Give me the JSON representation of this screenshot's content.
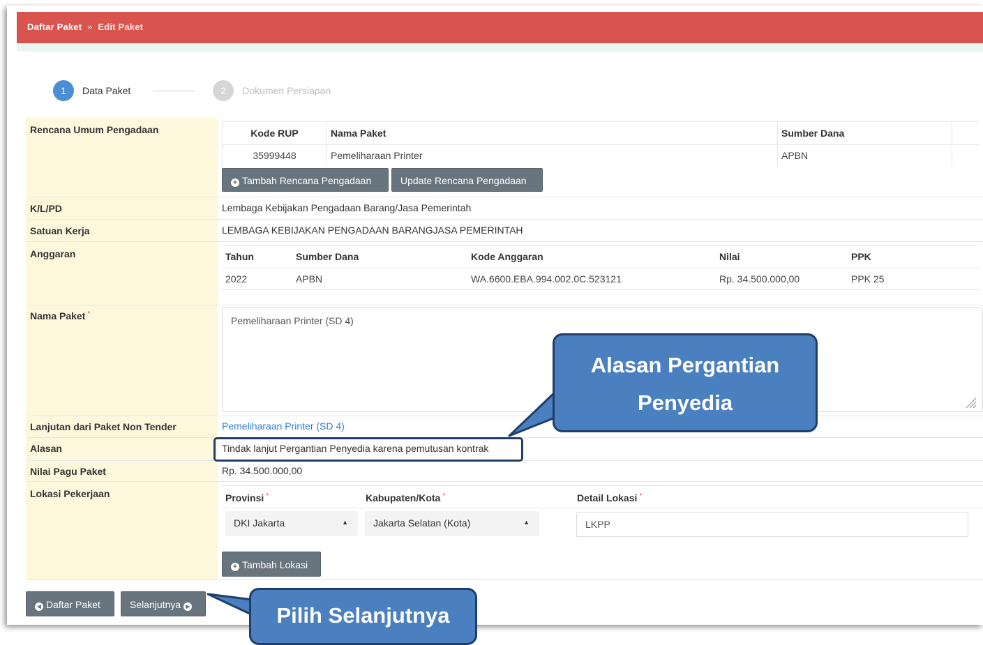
{
  "breadcrumb": {
    "item1": "Daftar Paket",
    "separator": "»",
    "item2": "Edit Paket"
  },
  "steps": [
    {
      "number": "1",
      "label": "Data Paket"
    },
    {
      "number": "2",
      "label": "Dokumen Persiapan"
    }
  ],
  "rup": {
    "label": "Rencana Umum Pengadaan",
    "headers": [
      "Kode RUP",
      "Nama Paket",
      "Sumber Dana"
    ],
    "rows": [
      [
        "35999448",
        "Pemeliharaan Printer",
        "APBN"
      ]
    ],
    "add_button": "Tambah Rencana Pengadaan",
    "update_button": "Update Rencana Pengadaan"
  },
  "klpd": {
    "label": "K/L/PD",
    "value": "Lembaga Kebijakan Pengadaan Barang/Jasa Pemerintah"
  },
  "satker": {
    "label": "Satuan Kerja",
    "value": "LEMBAGA KEBIJAKAN PENGADAAN BARANGJASA PEMERINTAH"
  },
  "anggaran": {
    "label": "Anggaran",
    "headers": [
      "Tahun",
      "Sumber Dana",
      "Kode Anggaran",
      "Nilai",
      "PPK"
    ],
    "rows": [
      [
        "2022",
        "APBN",
        "WA.6600.EBA.994.002.0C.523121",
        "Rp. 34.500.000,00",
        "PPK 25"
      ]
    ]
  },
  "nama_paket": {
    "label": "Nama Paket",
    "required": "*",
    "value": "Pemeliharaan Printer (SD 4)"
  },
  "lanjutan": {
    "label": "Lanjutan dari Paket Non Tender",
    "value": "Pemeliharaan Printer (SD 4)"
  },
  "alasan": {
    "label": "Alasan",
    "value": "Tindak lanjut Pergantian Penyedia karena pemutusan kontrak"
  },
  "pagu": {
    "label": "Nilai Pagu Paket",
    "value": "Rp. 34.500.000,00"
  },
  "lokasi": {
    "label": "Lokasi Pekerjaan",
    "headers": [
      "Provinsi",
      "Kabupaten/Kota",
      "Detail Lokasi"
    ],
    "required": "*",
    "provinsi": "DKI Jakarta",
    "kota": "Jakarta Selatan (Kota)",
    "detail": "LKPP",
    "add_button": "Tambah Lokasi"
  },
  "footer": {
    "back_button": "Daftar Paket",
    "next_button": "Selanjutnya"
  },
  "callouts": {
    "alasan_line1": "Alasan Pergantian",
    "alasan_line2": "Penyedia",
    "next": "Pilih Selanjutnya"
  },
  "colors": {
    "header": "#d9534f",
    "callout": "#4a7fc0",
    "callout_border": "#1f3e6a",
    "button": "#68747e",
    "label_bg": "#fdf8dc",
    "step_active": "#4a8fd6"
  }
}
